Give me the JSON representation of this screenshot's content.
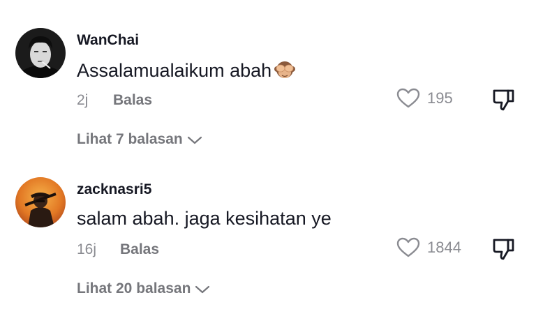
{
  "comments": [
    {
      "username": "WanChai",
      "text": "Assalamualaikum abah",
      "emoji": "see-no-evil-monkey-icon",
      "time": "2j",
      "reply_label": "Balas",
      "likes": "195",
      "view_replies": "Lihat 7 balasan"
    },
    {
      "username": "zacknasri5",
      "text": "salam abah. jaga kesihatan ye",
      "time": "16j",
      "reply_label": "Balas",
      "likes": "1844",
      "view_replies": "Lihat 20 balasan"
    }
  ],
  "colors": {
    "primary_text": "#161823",
    "secondary_text": "#8a8b91",
    "bold_secondary": "#75767b"
  }
}
